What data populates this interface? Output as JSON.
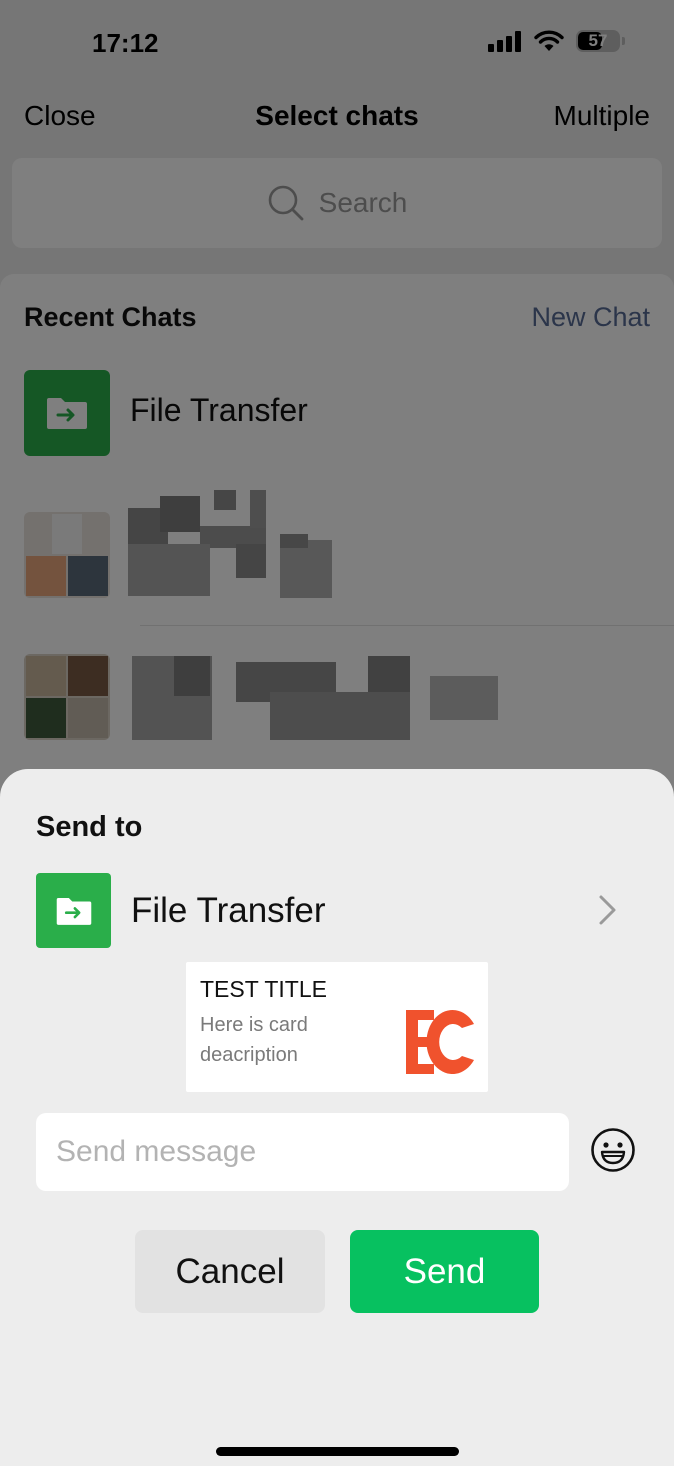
{
  "status_bar": {
    "time": "17:12",
    "battery": "57"
  },
  "nav": {
    "close": "Close",
    "title": "Select chats",
    "multiple": "Multiple"
  },
  "search": {
    "placeholder": "Search"
  },
  "recent": {
    "title": "Recent Chats",
    "new_chat": "New Chat",
    "items": [
      {
        "name": "File Transfer"
      }
    ]
  },
  "sheet": {
    "send_to": "Send to",
    "target": "File Transfer",
    "card": {
      "title": "TEST TITLE",
      "description": "Here is card deacription",
      "logo": "EC"
    },
    "message_placeholder": "Send message",
    "cancel": "Cancel",
    "send": "Send"
  },
  "colors": {
    "accent": "#07c160",
    "link": "#576b95",
    "file_transfer": "#2aae4a",
    "logo": "#f0522d"
  }
}
